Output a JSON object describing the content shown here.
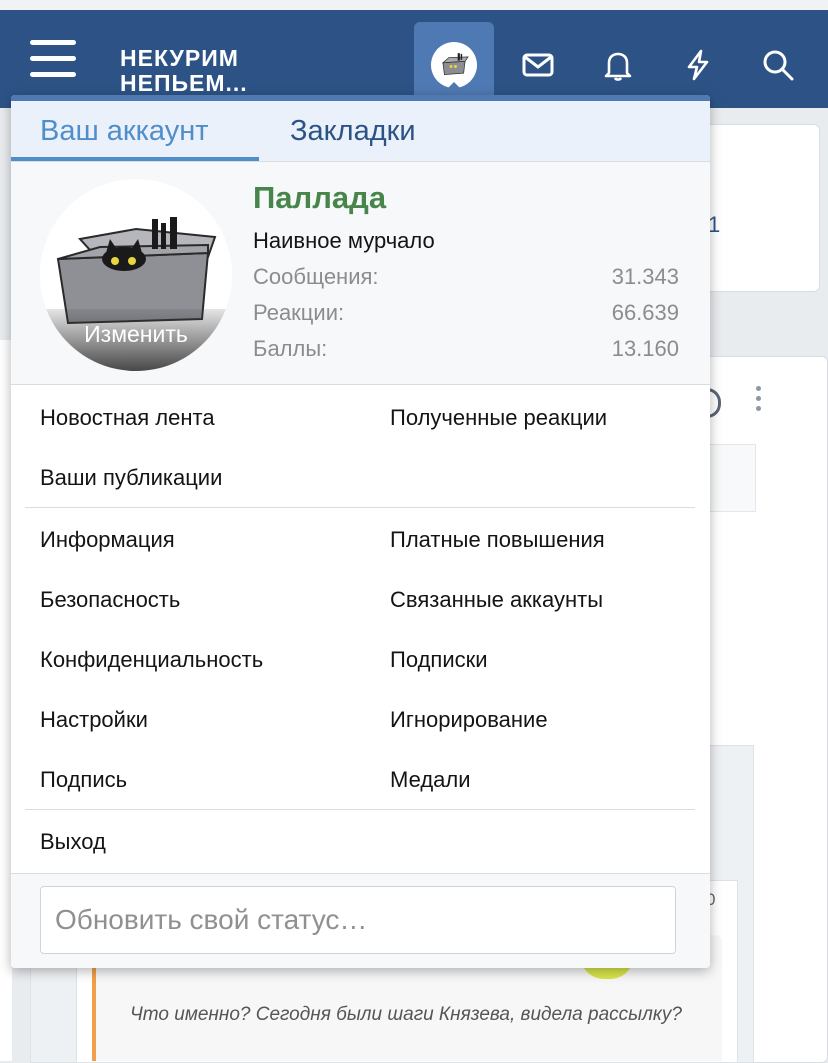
{
  "header": {
    "logo_line1": "НЕКУРИМ",
    "logo_line2": "НЕПЬЕМ...",
    "icons": [
      "menu-icon",
      "avatar-icon",
      "mail-icon",
      "bell-icon",
      "lightning-icon",
      "search-icon"
    ]
  },
  "background": {
    "card_text": "1",
    "zero": "0",
    "quote_text": "Что именно? Сегодня были шаги Князева, видела рассылку?"
  },
  "menu": {
    "tabs": [
      {
        "label": "Ваш аккаунт",
        "active": true
      },
      {
        "label": "Закладки",
        "active": false
      }
    ],
    "profile": {
      "username": "Паллада",
      "user_title": "Наивное мурчало",
      "avatar_edit": "Изменить",
      "stats": [
        {
          "label": "Сообщения:",
          "value": "31.343"
        },
        {
          "label": "Реакции:",
          "value": "66.639"
        },
        {
          "label": "Баллы:",
          "value": "13.160"
        }
      ]
    },
    "links_group1": {
      "left": [
        "Новостная лента",
        "Ваши публикации"
      ],
      "right": [
        "Полученные реакции"
      ]
    },
    "links_group2": {
      "left": [
        "Информация",
        "Безопасность",
        "Конфиденциальность",
        "Настройки",
        "Подпись"
      ],
      "right": [
        "Платные повышения",
        "Связанные аккаунты",
        "Подписки",
        "Игнорирование",
        "Медали"
      ]
    },
    "logout": "Выход",
    "status_placeholder": "Обновить свой статус…"
  },
  "colors": {
    "navbar": "#2d5386",
    "accent": "#4f8ec9",
    "username": "#47854b"
  }
}
